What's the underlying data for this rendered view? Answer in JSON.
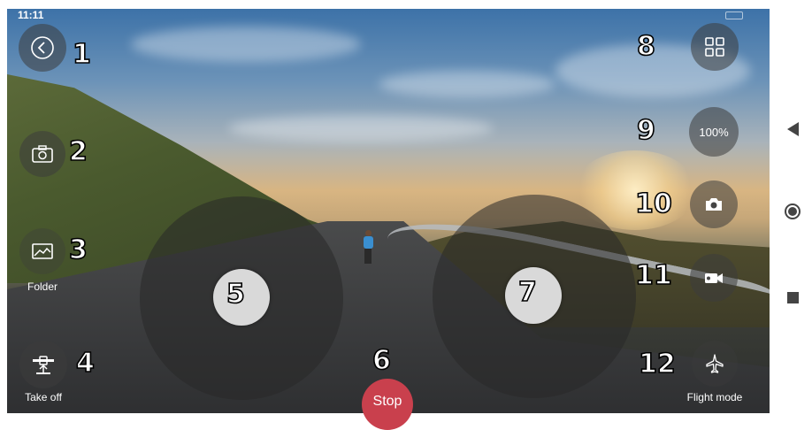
{
  "status": {
    "time": "11:11"
  },
  "controls": {
    "back": {
      "icon": "chevron-left-icon"
    },
    "gallery": {
      "icon": "image-gallery-icon"
    },
    "folder": {
      "label": "Folder",
      "icon": "folder-image-icon"
    },
    "takeoff": {
      "label": "Take off",
      "icon": "takeoff-icon"
    },
    "stop": {
      "label": "Stop"
    },
    "grid": {
      "icon": "grid-icon"
    },
    "speed": {
      "value": "100%"
    },
    "photo": {
      "icon": "camera-icon"
    },
    "video": {
      "icon": "video-camera-icon"
    },
    "flight_mode": {
      "label": "Flight mode",
      "icon": "airplane-icon"
    }
  },
  "annotations": [
    "1",
    "2",
    "3",
    "4",
    "5",
    "6",
    "7",
    "8",
    "9",
    "10",
    "11",
    "12"
  ],
  "colors": {
    "stop": "#c9404d",
    "control_bg": "rgba(60,60,60,0.55)",
    "knob": "#d9d9d9"
  }
}
